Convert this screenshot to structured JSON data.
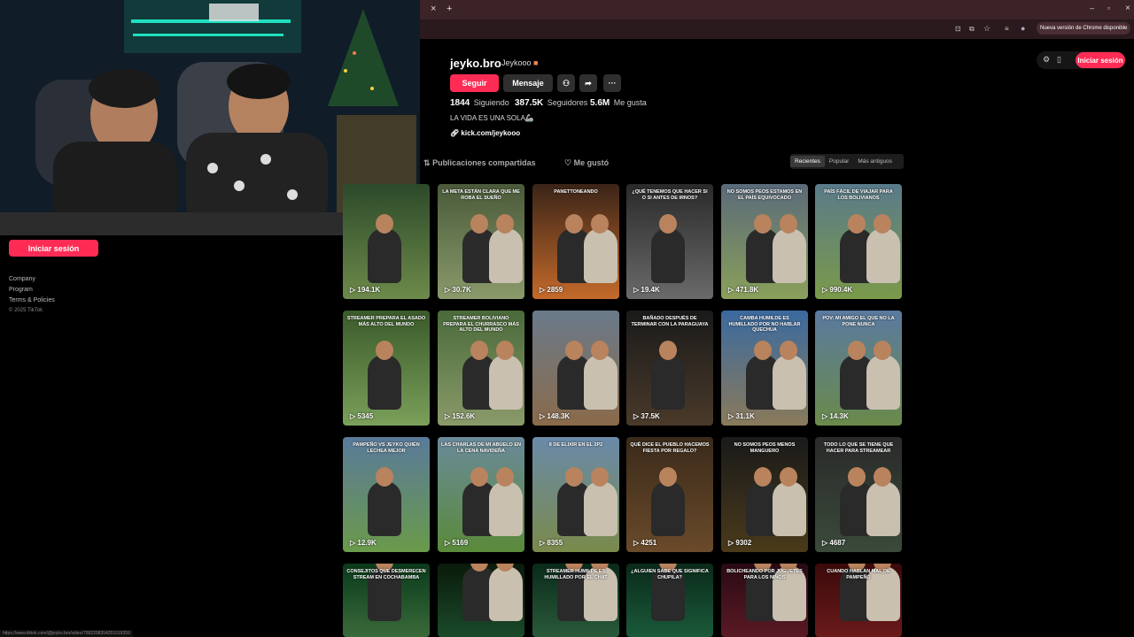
{
  "browser": {
    "update_label": "Nueva versión de Chrome disponible",
    "new_tab_symbol": "+",
    "close_tab_symbol": "×",
    "status_url": "https://www.tiktok.com/@jeyko.bro/video/7582298354251616359"
  },
  "header": {
    "login_label": "Iniciar sesión"
  },
  "sidebar": {
    "login_label": "Iniciar sesión",
    "links": [
      "Company",
      "Program",
      "Terms & Policies"
    ],
    "copyright": "© 2025 TikTok"
  },
  "profile": {
    "username": "jeyko.bro",
    "nickname": "Jeykooo",
    "follow_label": "Seguir",
    "message_label": "Mensaje",
    "following_count": "1844",
    "following_label": "Siguiendo",
    "followers_count": "387.5K",
    "followers_label": "Seguidores",
    "likes_count": "5.6M",
    "likes_label": "Me gusta",
    "bio": "LA VIDA ES UNA SOLA🦾",
    "link": "kick.com/jeykooo"
  },
  "tabs": {
    "reposts": "Publicaciones compartidas",
    "liked": "Me gustó"
  },
  "sort": {
    "recent": "Recientes",
    "popular": "Popular",
    "oldest": "Más antiguos"
  },
  "videos": [
    {
      "views": "194.1K",
      "caption": ""
    },
    {
      "views": "30.7K",
      "caption": "LA META ESTÁN CLARA QUE ME ROBA EL SUEÑO"
    },
    {
      "views": "2859",
      "caption": "PANETTONEANDO"
    },
    {
      "views": "19.4K",
      "caption": "¿QUÉ TENEMOS QUE HACER SI O SI ANTES DE IRNOS?"
    },
    {
      "views": "471.8K",
      "caption": "NO SOMOS PEOS ESTAMOS EN EL PAÍS EQUIVOCADO"
    },
    {
      "views": "990.4K",
      "caption": "PAÍS FÁCIL DE VIAJAR PARA LOS BOLIVIANOS"
    },
    {
      "views": "5345",
      "caption": "STREAMER PREPARA EL ASADO MÁS ALTO DEL MUNDO"
    },
    {
      "views": "152.6K",
      "caption": "STREAMER BOLIVIANO PREPARA EL CHURRASCO MÁS ALTO DEL MUNDO"
    },
    {
      "views": "148.3K",
      "caption": ""
    },
    {
      "views": "37.5K",
      "caption": "BAÑADO DESPUÉS DE TERMINAR CON LA PARAGUAYA"
    },
    {
      "views": "31.1K",
      "caption": "CAMBA HUMILDE ES HUMILLADO POR NO HABLAR QUECHUA"
    },
    {
      "views": "14.3K",
      "caption": "POV: MI AMIGO EL QUE NO LA PONE NUNCA"
    },
    {
      "views": "12.9K",
      "caption": "PAMPEÑO VS JEYKO QUIÉN LECHEA MEJOR"
    },
    {
      "views": "5169",
      "caption": "LAS CHARLAS DE MI ABUELO EN LA CENA NAVIDEÑA"
    },
    {
      "views": "8355",
      "caption": "8 DE ELIXIR EN EL 2P2"
    },
    {
      "views": "4251",
      "caption": "QUÉ DICE EL PUEBLO HACEMOS FIESTA POR REGALO?"
    },
    {
      "views": "9302",
      "caption": "NO SOMOS PEOS MENOS MANGUERO"
    },
    {
      "views": "4687",
      "caption": "TODO LO QUE SE TIENE QUE HACER PARA STREAMEAR"
    },
    {
      "views": "",
      "caption": "CONSEJITOS QUE DESMERECEN STREAM EN COCHABAMBA"
    },
    {
      "views": "",
      "caption": ""
    },
    {
      "views": "",
      "caption": "STREAMER HUMILDE ES HUMILLADO POR EL CHAT"
    },
    {
      "views": "",
      "caption": "¿ALGUIEN SABE QUE SIGNIFICA CHUPILA?"
    },
    {
      "views": "",
      "caption": "BOLICHEANDO POR JUGUETES PARA LOS NIÑOS"
    },
    {
      "views": "",
      "caption": "CUANDO HABLAN MAL DE PAMPEÑO"
    }
  ]
}
